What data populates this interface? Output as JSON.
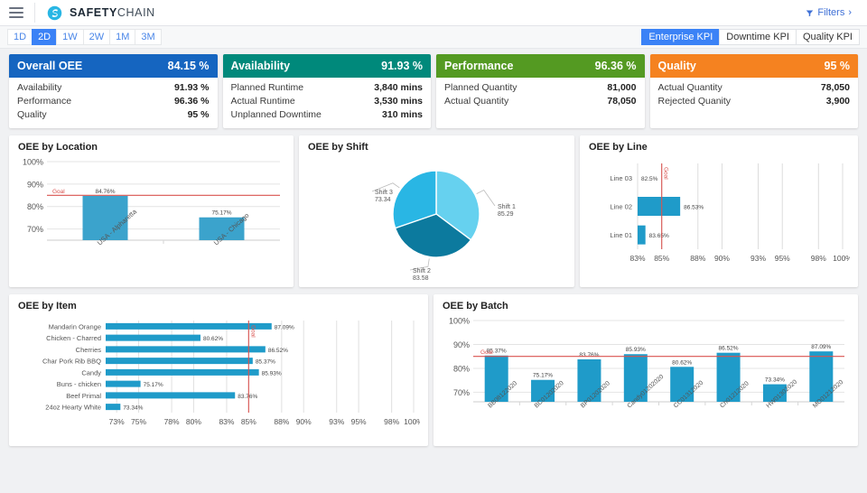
{
  "header": {
    "menu_icon": "hamburger-icon",
    "brand_bold": "SAFETY",
    "brand_light": "CHAIN",
    "filters_label": "Filters",
    "filters_chevron": "›"
  },
  "ranges": {
    "items": [
      {
        "label": "1D",
        "active": false
      },
      {
        "label": "2D",
        "active": true
      },
      {
        "label": "1W",
        "active": false
      },
      {
        "label": "2W",
        "active": false
      },
      {
        "label": "1M",
        "active": false
      },
      {
        "label": "3M",
        "active": false
      }
    ]
  },
  "kpi_tabs": {
    "items": [
      {
        "label": "Enterprise KPI",
        "active": true
      },
      {
        "label": "Downtime KPI",
        "active": false
      },
      {
        "label": "Quality KPI",
        "active": false
      }
    ]
  },
  "kpi_cards": [
    {
      "title": "Overall OEE",
      "value": "84.15 %",
      "color": "#1565c0",
      "rows": [
        {
          "label": "Availability",
          "value": "91.93 %"
        },
        {
          "label": "Performance",
          "value": "96.36 %"
        },
        {
          "label": "Quality",
          "value": "95 %"
        }
      ]
    },
    {
      "title": "Availability",
      "value": "91.93 %",
      "color": "#00897b",
      "rows": [
        {
          "label": "Planned Runtime",
          "value": "3,840 mins"
        },
        {
          "label": "Actual Runtime",
          "value": "3,530 mins"
        },
        {
          "label": "Unplanned Downtime",
          "value": "310 mins"
        }
      ]
    },
    {
      "title": "Performance",
      "value": "96.36 %",
      "color": "#549a22",
      "rows": [
        {
          "label": "Planned Quantity",
          "value": "81,000"
        },
        {
          "label": "Actual Quantity",
          "value": "78,050"
        }
      ]
    },
    {
      "title": "Quality",
      "value": "95 %",
      "color": "#f58220",
      "rows": [
        {
          "label": "Actual Quantity",
          "value": "78,050"
        },
        {
          "label": "Rejected Quanity",
          "value": "3,900"
        }
      ]
    }
  ],
  "chart_data": [
    {
      "type": "bar",
      "title": "OEE by Location",
      "categories": [
        "USA - Alpharetta",
        "USA - Chicago"
      ],
      "values": [
        84.76,
        75.17
      ],
      "value_labels": [
        "84.76%",
        "75.17%"
      ],
      "ylabel": "",
      "xlabel": "",
      "ylim": [
        65,
        100
      ],
      "yticks": [
        70,
        80,
        90,
        100
      ],
      "ytick_labels": [
        "70%",
        "80%",
        "90%",
        "100%"
      ],
      "goal": 85,
      "goal_label": "Goal",
      "goal_color": "#d9534f",
      "bar_color": "#3ba3cc",
      "grid": true,
      "legend": "none"
    },
    {
      "type": "pie",
      "title": "OEE by Shift",
      "labels": [
        "Shift 1",
        "Shift 2",
        "Shift 3"
      ],
      "values": [
        85.29,
        83.58,
        73.34
      ],
      "value_labels": [
        "85.29",
        "83.58",
        "73.34"
      ],
      "colors": [
        "#66d1ef",
        "#0c7a9e",
        "#29b6e4"
      ],
      "legend": "none"
    },
    {
      "type": "bar",
      "orientation": "horizontal",
      "title": "OEE by Line",
      "categories": [
        "Line 03",
        "Line 02",
        "Line 01"
      ],
      "values": [
        82.5,
        86.53,
        83.65
      ],
      "value_labels": [
        "82.5%",
        "86.53%",
        "83.65%"
      ],
      "xlim": [
        83,
        100
      ],
      "xticks": [
        83,
        85,
        88,
        90,
        93,
        95,
        98,
        100
      ],
      "xtick_labels": [
        "83%",
        "85%",
        "88%",
        "90%",
        "93%",
        "95%",
        "98%",
        "100%"
      ],
      "goal": 85,
      "goal_label": "Goal",
      "goal_color": "#d9534f",
      "bar_color": "#1f9bc9",
      "grid": true,
      "legend": "none"
    },
    {
      "type": "bar",
      "orientation": "horizontal",
      "title": "OEE by Item",
      "categories": [
        "Mandarin Orange",
        "Chicken - Charred",
        "Cherries",
        "Char Pork Rib BBQ",
        "Candy",
        "Buns - chicken",
        "Beef Primal",
        "24oz Hearty White"
      ],
      "values": [
        87.09,
        80.62,
        86.52,
        85.37,
        85.93,
        75.17,
        83.76,
        73.34
      ],
      "value_labels": [
        "87.09%",
        "80.62%",
        "86.52%",
        "85.37%",
        "85.93%",
        "75.17%",
        "83.76%",
        "73.34%"
      ],
      "xlim": [
        72,
        100
      ],
      "xticks": [
        73,
        75,
        78,
        80,
        83,
        85,
        88,
        90,
        93,
        95,
        98,
        100
      ],
      "xtick_labels": [
        "73%",
        "75%",
        "78%",
        "80%",
        "83%",
        "85%",
        "88%",
        "90%",
        "93%",
        "95%",
        "98%",
        "100%"
      ],
      "goal": 85,
      "goal_label": "Goal",
      "goal_color": "#d9534f",
      "bar_color": "#1f9bc9",
      "grid": true,
      "legend": "none"
    },
    {
      "type": "bar",
      "title": "OEE by Batch",
      "categories": [
        "BB08122020",
        "BC01202020",
        "BP01202020",
        "Candy01202020",
        "CC01312020",
        "Ch01212020",
        "HW01302020",
        "MO01212020"
      ],
      "values": [
        85.37,
        75.17,
        83.76,
        85.93,
        80.62,
        86.52,
        73.34,
        87.09
      ],
      "value_labels": [
        "85.37%",
        "75.17%",
        "83.76%",
        "85.93%",
        "80.62%",
        "86.52%",
        "73.34%",
        "87.09%"
      ],
      "ylim": [
        66,
        100
      ],
      "yticks": [
        70,
        80,
        90,
        100
      ],
      "ytick_labels": [
        "70%",
        "80%",
        "90%",
        "100%"
      ],
      "goal": 85,
      "goal_label": "Goal",
      "goal_color": "#d9534f",
      "bar_color": "#1f9bc9",
      "grid": true,
      "legend": "none"
    }
  ]
}
